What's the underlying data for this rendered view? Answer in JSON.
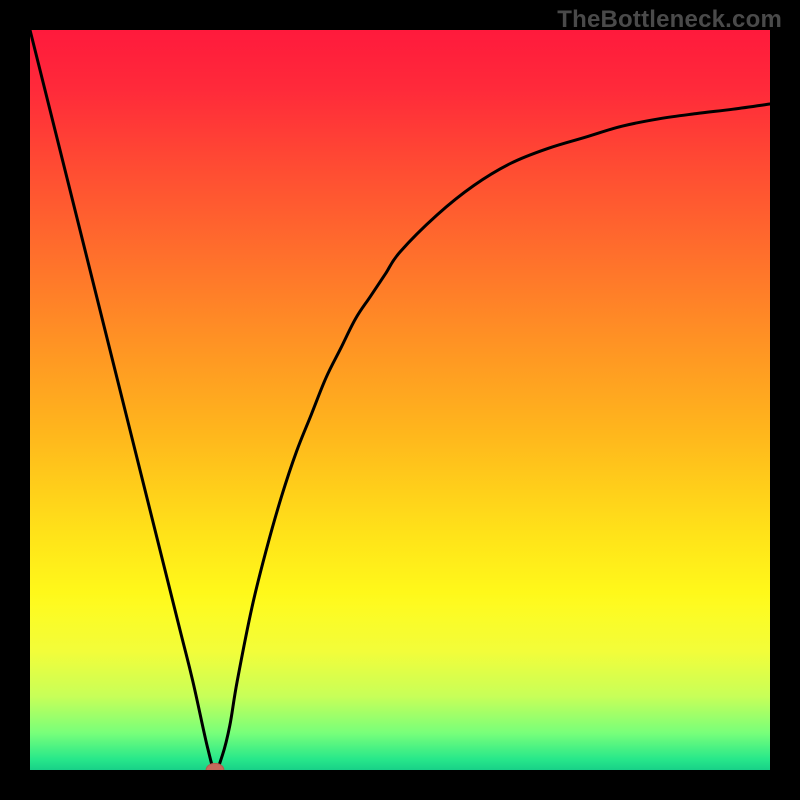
{
  "watermark": "TheBottleneck.com",
  "colors": {
    "frame": "#000000",
    "curve": "#000000",
    "marker_fill": "#c46a5c",
    "marker_stroke": "#b55a4c",
    "gradient_stops": [
      {
        "offset": 0.0,
        "color": "#ff1a3c"
      },
      {
        "offset": 0.08,
        "color": "#ff2a3a"
      },
      {
        "offset": 0.18,
        "color": "#ff4a33"
      },
      {
        "offset": 0.3,
        "color": "#ff6e2c"
      },
      {
        "offset": 0.42,
        "color": "#ff9224"
      },
      {
        "offset": 0.55,
        "color": "#ffb81c"
      },
      {
        "offset": 0.68,
        "color": "#ffe219"
      },
      {
        "offset": 0.76,
        "color": "#fff81a"
      },
      {
        "offset": 0.78,
        "color": "#fdfb22"
      },
      {
        "offset": 0.84,
        "color": "#f2fd3a"
      },
      {
        "offset": 0.9,
        "color": "#c8ff58"
      },
      {
        "offset": 0.95,
        "color": "#78ff7a"
      },
      {
        "offset": 0.985,
        "color": "#28e88a"
      },
      {
        "offset": 1.0,
        "color": "#18d088"
      }
    ]
  },
  "chart_data": {
    "type": "line",
    "title": "",
    "xlabel": "",
    "ylabel": "",
    "xlim": [
      0,
      100
    ],
    "ylim": [
      0,
      100
    ],
    "grid": false,
    "series": [
      {
        "name": "bottleneck-curve",
        "x": [
          0,
          5,
          10,
          15,
          20,
          22,
          24,
          25,
          26,
          27,
          28,
          30,
          32,
          34,
          36,
          38,
          40,
          42,
          44,
          46,
          48,
          50,
          55,
          60,
          65,
          70,
          75,
          80,
          85,
          90,
          95,
          100
        ],
        "y": [
          100,
          80,
          60,
          40,
          20,
          12,
          3,
          0,
          2,
          6,
          12,
          22,
          30,
          37,
          43,
          48,
          53,
          57,
          61,
          64,
          67,
          70,
          75,
          79,
          82,
          84,
          85.5,
          87,
          88,
          88.7,
          89.3,
          90
        ]
      }
    ],
    "marker": {
      "x": 25,
      "y": 0,
      "rx": 1.2,
      "ry": 0.9
    },
    "annotations": []
  }
}
